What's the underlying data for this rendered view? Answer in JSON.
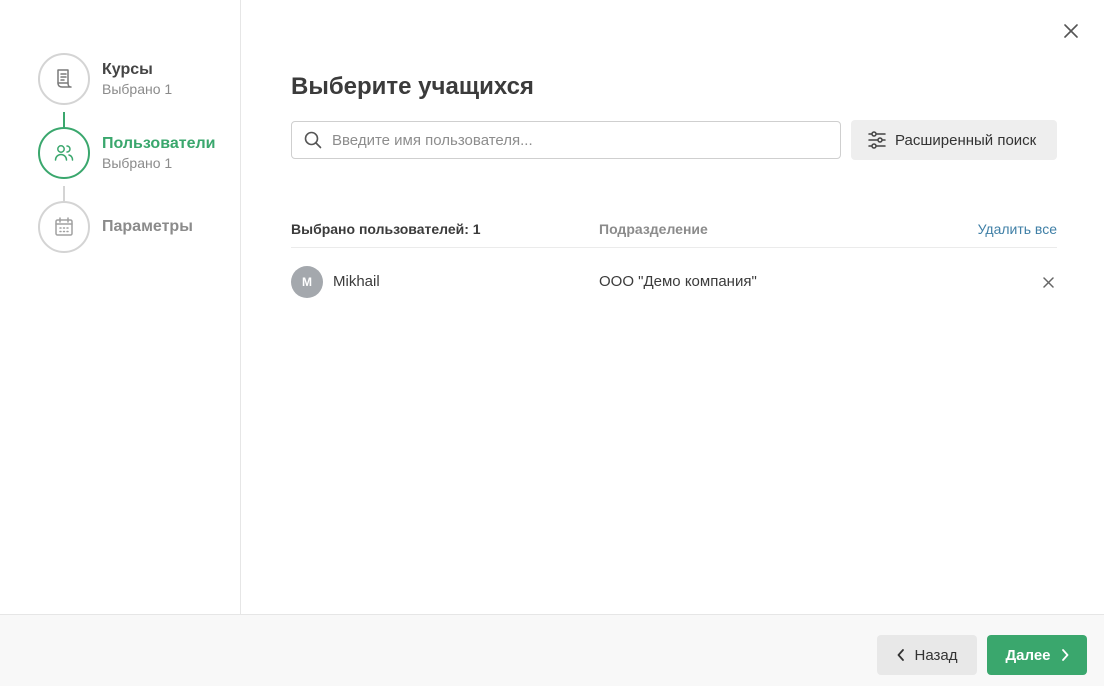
{
  "colors": {
    "accent": "#3aa76d",
    "link": "#3f7fa6",
    "muted": "#8b8b8b",
    "avatar_bg": "#a4a8ad"
  },
  "steps": [
    {
      "title": "Курсы",
      "subtitle": "Выбрано 1",
      "icon": "document-icon",
      "state": "done"
    },
    {
      "title": "Пользователи",
      "subtitle": "Выбрано 1",
      "icon": "users-icon",
      "state": "active"
    },
    {
      "title": "Параметры",
      "subtitle": "",
      "icon": "calendar-icon",
      "state": "pending"
    }
  ],
  "dialog": {
    "close_icon": "close-icon",
    "title": "Выберите учащихся"
  },
  "search": {
    "icon": "search-icon",
    "value": "",
    "placeholder": "Введите имя пользователя..."
  },
  "advanced_search": {
    "icon": "sliders-icon",
    "label": "Расширенный поиск"
  },
  "table": {
    "count_label": "Выбрано пользователей: 1",
    "department_header": "Подразделение",
    "remove_all_label": "Удалить все",
    "rows": [
      {
        "avatar_initial": "M",
        "name": "Mikhail",
        "department": "ООО \"Демо компания\""
      }
    ]
  },
  "footer": {
    "back_label": "Назад",
    "next_label": "Далее"
  }
}
